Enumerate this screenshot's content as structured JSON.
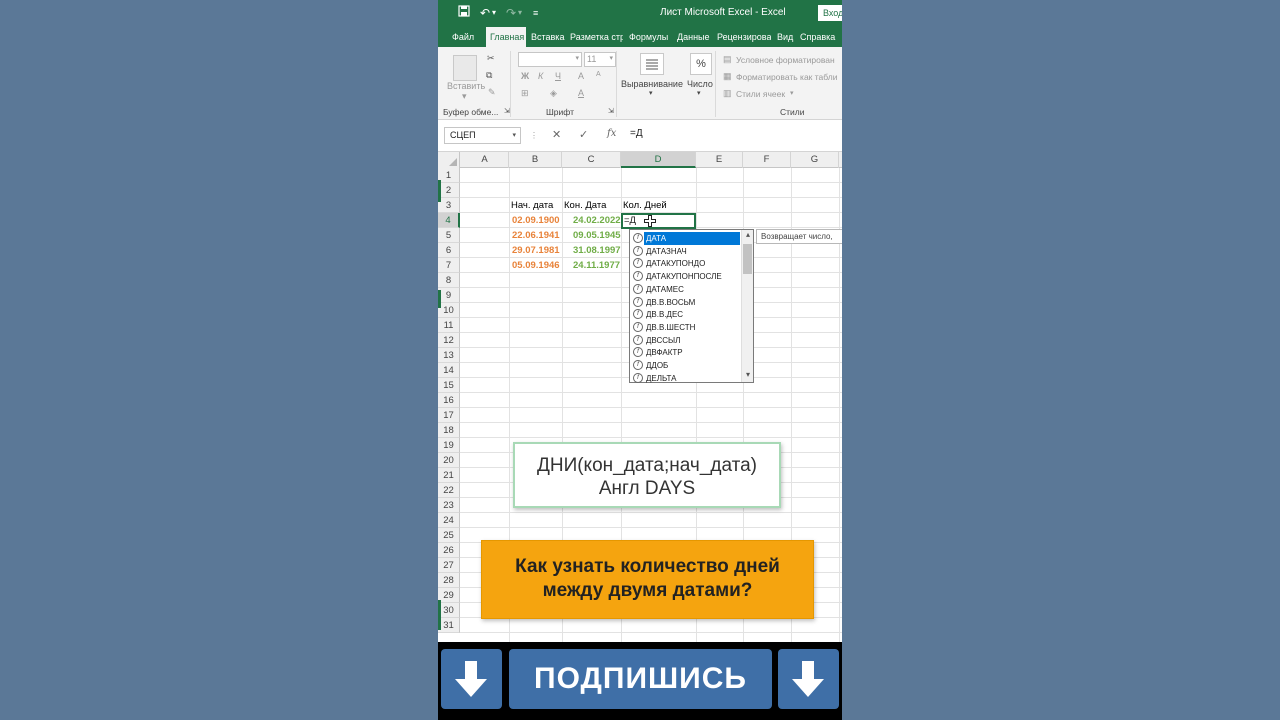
{
  "window": {
    "title": "Лист Microsoft Excel  -  Excel",
    "login": "Вход"
  },
  "tabs": [
    "Файл",
    "Главная",
    "Вставка",
    "Разметка стр",
    "Формулы",
    "Данные",
    "Рецензирова",
    "Вид",
    "Справка"
  ],
  "active_tab": "Главная",
  "ribbon": {
    "paste": "Вставить",
    "font_name": "",
    "font_size": "11",
    "bold": "Ж",
    "italic": "К",
    "underline": "Ч",
    "alignment": "Выравнивание",
    "number": "Число",
    "percent": "%",
    "styles_items": [
      "Условное форматирован",
      "Форматировать как табли",
      "Стили ячеек"
    ],
    "groups": {
      "clipboard": "Буфер обме...",
      "font": "Шрифт",
      "styles": "Стили"
    }
  },
  "formula_bar": {
    "name_box": "СЦЕП",
    "cancel": "✕",
    "enter": "✓",
    "fx": "fx",
    "formula": "=Д"
  },
  "grid": {
    "columns": [
      "A",
      "B",
      "C",
      "D",
      "E",
      "F",
      "G"
    ],
    "selected_column": "D",
    "rows": [
      "1",
      "2",
      "3",
      "4",
      "5",
      "6",
      "7",
      "8",
      "9",
      "10",
      "11",
      "12",
      "13",
      "14",
      "15",
      "16",
      "17",
      "18",
      "19",
      "20",
      "21",
      "22",
      "23",
      "24",
      "25",
      "26",
      "27",
      "28",
      "29",
      "30",
      "31"
    ],
    "selected_row": "4",
    "headers": {
      "b3": "Нач. дата",
      "c3": "Кон. Дата",
      "d3": "Кол. Дней"
    },
    "start_dates": [
      "02.09.1900",
      "22.06.1941",
      "29.07.1981",
      "05.09.1946"
    ],
    "end_dates": [
      "24.02.2022",
      "09.05.1945",
      "31.08.1997",
      "24.11.1977"
    ],
    "active_cell_value": "=Д"
  },
  "autocomplete": {
    "items": [
      "ДАТА",
      "ДАТАЗНАЧ",
      "ДАТАКУПОНДО",
      "ДАТАКУПОНПОСЛЕ",
      "ДАТАМЕС",
      "ДВ.В.ВОСЬМ",
      "ДВ.В.ДЕС",
      "ДВ.В.ШЕСТН",
      "ДВССЫЛ",
      "ДВФАКТР",
      "ДДОБ",
      "ДЕЛЬТА"
    ],
    "selected": "ДАТА",
    "tooltip": "Возвращает число,"
  },
  "overlay": {
    "hint_line1": "ДНИ(кон_дата;нач_дата)",
    "hint_line2": "Англ DAYS",
    "question_line1": "Как узнать количество дней",
    "question_line2": "между двумя датами?",
    "subscribe": "ПОДПИШИСЬ"
  },
  "colors": {
    "excel_green": "#217346",
    "start_date": "#e8833a",
    "end_date": "#70ad47",
    "question_bg": "#f5a40f",
    "subscribe_blue": "#3f6fa7",
    "page_bg": "#5b7897"
  }
}
